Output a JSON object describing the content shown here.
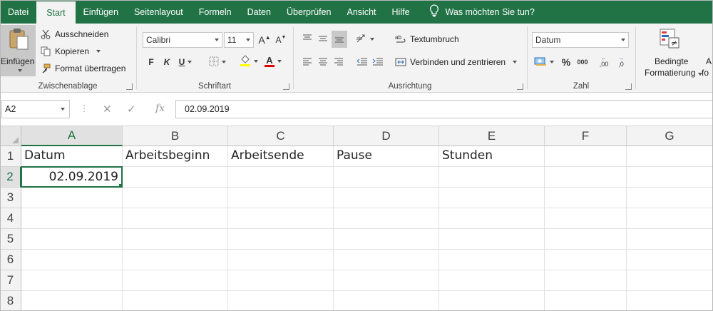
{
  "menu": {
    "tabs": [
      "Datei",
      "Start",
      "Einfügen",
      "Seitenlayout",
      "Formeln",
      "Daten",
      "Überprüfen",
      "Ansicht",
      "Hilfe"
    ],
    "active_tab": "Start",
    "tell_me": "Was möchten Sie tun?"
  },
  "ribbon": {
    "clipboard": {
      "paste": "Einfügen",
      "cut": "Ausschneiden",
      "copy": "Kopieren",
      "format_painter": "Format übertragen",
      "label": "Zwischenablage"
    },
    "font": {
      "name": "Calibri",
      "size": "11",
      "grow": "A",
      "shrink": "A",
      "bold": "F",
      "italic": "K",
      "underline": "U",
      "font_color_letter": "A",
      "label": "Schriftart"
    },
    "alignment": {
      "wrap": "Textumbruch",
      "merge": "Verbinden und zentrieren",
      "label": "Ausrichtung"
    },
    "number": {
      "format": "Datum",
      "percent": "%",
      "thousands": "000",
      "inc_decimal": ",00",
      "dec_decimal": ",0",
      "label": "Zahl"
    },
    "styles": {
      "conditional_line1": "Bedingte",
      "conditional_line2": "Formatierung",
      "next_partial_1": "A",
      "next_partial_2": "fo"
    }
  },
  "formula_bar": {
    "name_box": "A2",
    "fx": "fx",
    "value": "02.09.2019"
  },
  "grid": {
    "columns": [
      "A",
      "B",
      "C",
      "D",
      "E",
      "F",
      "G"
    ],
    "rows": [
      "1",
      "2",
      "3",
      "4",
      "5",
      "6",
      "7",
      "8"
    ],
    "selected_column": "A",
    "selected_row": "2",
    "cells": {
      "A1": "Datum",
      "B1": "Arbeitsbeginn",
      "C1": "Arbeitsende",
      "D1": "Pause",
      "E1": "Stunden",
      "A2": "02.09.2019"
    }
  },
  "colors": {
    "excel_green": "#217346",
    "ribbon_bg": "#f3f3f3",
    "gridline": "#e1e1e1"
  }
}
